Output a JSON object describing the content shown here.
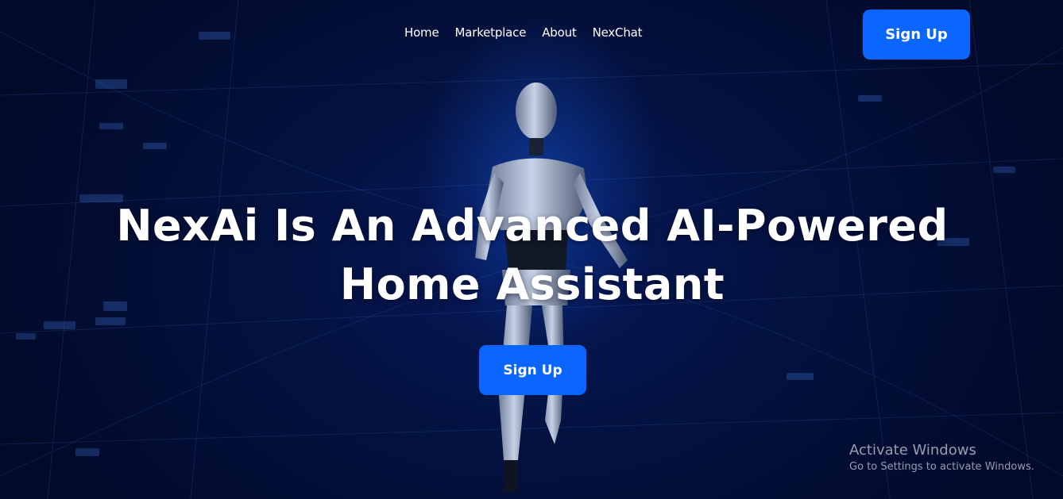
{
  "nav": {
    "items": [
      {
        "label": "Home"
      },
      {
        "label": "Marketplace"
      },
      {
        "label": "About"
      },
      {
        "label": "NexChat"
      }
    ],
    "cta_label": "Sign Up"
  },
  "hero": {
    "headline_line1": "NexAi Is An Advanced AI-Powered",
    "headline_line2": "Home Assistant",
    "cta_label": "Sign Up",
    "image_name": "robot-figure-image"
  },
  "watermark": {
    "title": "Activate Windows",
    "subtitle": "Go to Settings to activate Windows."
  },
  "colors": {
    "background": "#020a2a",
    "accent": "#0a66ff",
    "text": "#ffffff"
  }
}
